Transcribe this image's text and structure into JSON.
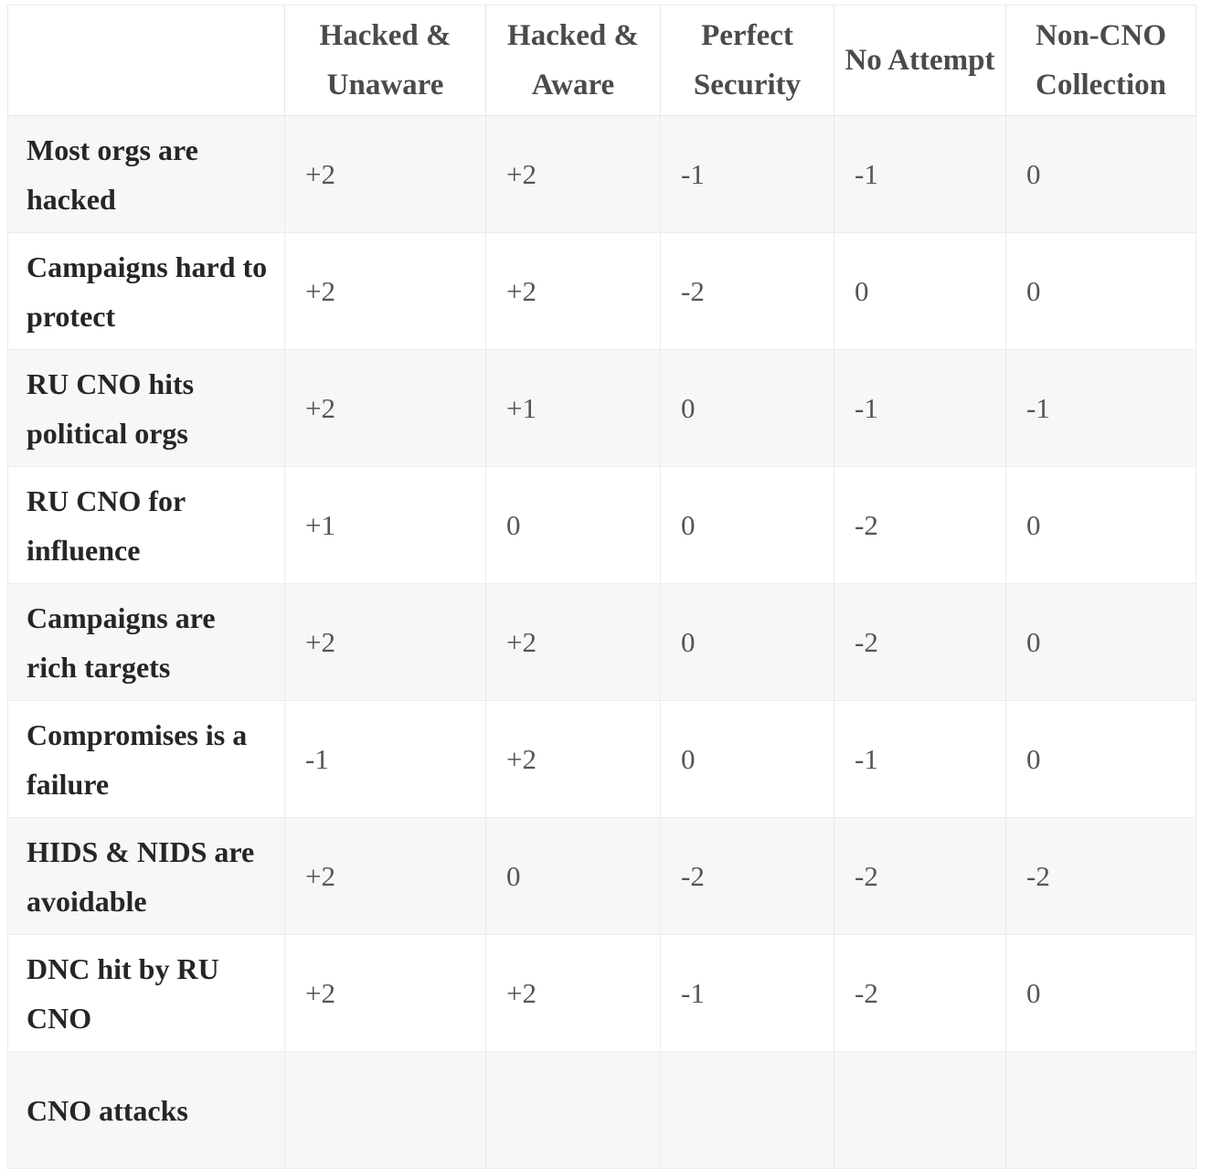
{
  "table": {
    "corner_header": "",
    "columns": [
      "Hacked & Unaware",
      "Hacked & Aware",
      "Perfect Security",
      "No Attempt",
      "Non-CNO Collection"
    ],
    "rows": [
      {
        "label": "Most orgs are hacked",
        "values": [
          "+2",
          "+2",
          "-1",
          "-1",
          "0"
        ]
      },
      {
        "label": "Campaigns hard to protect",
        "values": [
          "+2",
          "+2",
          "-2",
          "0",
          "0"
        ]
      },
      {
        "label": "RU CNO hits political orgs",
        "values": [
          "+2",
          "+1",
          "0",
          "-1",
          "-1"
        ]
      },
      {
        "label": "RU CNO for influence",
        "values": [
          "+1",
          "0",
          "0",
          "-2",
          "0"
        ]
      },
      {
        "label": "Campaigns are rich targets",
        "values": [
          "+2",
          "+2",
          "0",
          "-2",
          "0"
        ]
      },
      {
        "label": "Compromises is a failure",
        "values": [
          "-1",
          "+2",
          "0",
          "-1",
          "0"
        ]
      },
      {
        "label": "HIDS & NIDS are avoidable",
        "values": [
          "+2",
          "0",
          "-2",
          "-2",
          "-2"
        ]
      },
      {
        "label": "DNC hit by RU CNO",
        "values": [
          "+2",
          "+2",
          "-1",
          "-2",
          "0"
        ]
      },
      {
        "label": "CNO attacks",
        "values": [
          "",
          "",
          "",
          "",
          ""
        ]
      }
    ]
  },
  "chart_data": {
    "type": "table",
    "title": "",
    "categories": [
      "Hacked & Unaware",
      "Hacked & Aware",
      "Perfect Security",
      "No Attempt",
      "Non-CNO Collection"
    ],
    "series": [
      {
        "name": "Most orgs are hacked",
        "values": [
          2,
          2,
          -1,
          -1,
          0
        ]
      },
      {
        "name": "Campaigns hard to protect",
        "values": [
          2,
          2,
          -2,
          0,
          0
        ]
      },
      {
        "name": "RU CNO hits political orgs",
        "values": [
          2,
          1,
          0,
          -1,
          -1
        ]
      },
      {
        "name": "RU CNO for influence",
        "values": [
          1,
          0,
          0,
          -2,
          0
        ]
      },
      {
        "name": "Campaigns are rich targets",
        "values": [
          2,
          2,
          0,
          -2,
          0
        ]
      },
      {
        "name": "Compromises is a failure",
        "values": [
          -1,
          2,
          0,
          -1,
          0
        ]
      },
      {
        "name": "HIDS & NIDS are avoidable",
        "values": [
          2,
          0,
          -2,
          -2,
          -2
        ]
      },
      {
        "name": "DNC hit by RU CNO",
        "values": [
          2,
          2,
          -1,
          -2,
          0
        ]
      },
      {
        "name": "CNO attacks",
        "values": [
          null,
          null,
          null,
          null,
          null
        ]
      }
    ],
    "value_range": [
      -2,
      2
    ],
    "grid": true,
    "legend": "none"
  },
  "colors": {
    "row_stripe": "#f7f7f7",
    "row_plain": "#ffffff",
    "border": "#ececec",
    "header_text": "#4b4b4b",
    "label_text": "#262626",
    "value_text": "#555555"
  }
}
